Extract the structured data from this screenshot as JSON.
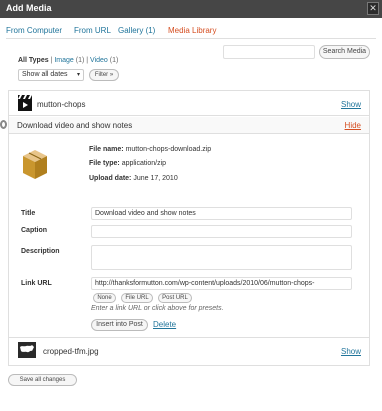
{
  "window": {
    "title": "Add Media",
    "close_glyph": "✕"
  },
  "tabs": [
    {
      "label": "From Computer",
      "active": false
    },
    {
      "label": "From URL",
      "active": false
    },
    {
      "label": "Gallery (1)",
      "active": false
    },
    {
      "label": "Media Library",
      "active": true
    }
  ],
  "search": {
    "placeholder": "",
    "button_label": "Search Media"
  },
  "type_filter": {
    "all_label": "All Types",
    "separator": " | ",
    "image_label": "Image",
    "image_count": "(1)",
    "video_label": "Video",
    "video_count": "(1)"
  },
  "date_filter": {
    "selected": "Show all dates",
    "arrow": "▾",
    "filter_button": "Filter »"
  },
  "media_items": {
    "first": {
      "name": "mutton-chops",
      "show_label": "Show",
      "icon": "video-clapper-icon"
    },
    "detail": {
      "title": "Download video and show notes",
      "hide_label": "Hide",
      "icon": "zip-archive-icon",
      "file_name_label": "File name:",
      "file_name": "mutton-chops-download.zip",
      "file_type_label": "File type:",
      "file_type": "application/zip",
      "upload_date_label": "Upload date:",
      "upload_date": "June 17, 2010",
      "fields": {
        "title_label": "Title",
        "title_value": "Download video and show notes",
        "caption_label": "Caption",
        "caption_value": "",
        "description_label": "Description",
        "description_value": "",
        "link_url_label": "Link URL",
        "link_url_value": "http://thanksformutton.com/wp-content/uploads/2010/06/mutton-chops-"
      },
      "url_buttons": [
        "None",
        "File URL",
        "Post URL"
      ],
      "url_hint": "Enter a link URL or click above for presets.",
      "insert_button": "Insert into Post",
      "delete_label": "Delete"
    },
    "second": {
      "name": "cropped-tfm.jpg",
      "show_label": "Show",
      "icon": "image-thumbnail-icon"
    }
  },
  "footer": {
    "save_all_label": "Save all changes"
  }
}
